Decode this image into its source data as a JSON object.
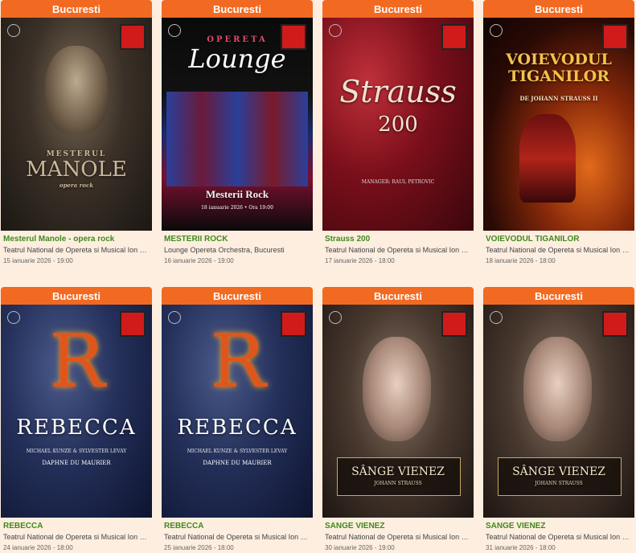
{
  "events": [
    {
      "city": "Bucuresti",
      "title": "Mesterul Manole - opera rock",
      "venue": "Teatrul National de Opereta si Musical Ion Dacia...",
      "date": "15 ianuarie 2026 - 19:00",
      "poster_title": "MANOLE",
      "poster_over": "MESTERUL",
      "poster_sub": "opera rock",
      "icon": "poster-mesterul-manole"
    },
    {
      "city": "Bucuresti",
      "title": "MESTERII ROCK",
      "venue": "Lounge Opereta Orchestra, Bucuresti",
      "date": "16 ianuarie 2026 - 19:00",
      "poster_title": "Lounge",
      "poster_over": "OPERETA",
      "poster_sub": "Mesterii Rock",
      "poster_extra": "18 ianuarie 2026 • Ora 19:00",
      "icon": "poster-mesterii-rock"
    },
    {
      "city": "Bucuresti",
      "title": "Strauss 200",
      "venue": "Teatrul National de Opereta si Musical Ion Dacia...",
      "date": "17 ianuarie 2026 - 18:00",
      "poster_title": "Strauss",
      "poster_sub": "200",
      "poster_extra": "MANAGER: RAUL PETROVIC",
      "icon": "poster-strauss-200"
    },
    {
      "city": "Bucuresti",
      "title": "VOIEVODUL TIGANILOR",
      "venue": "Teatrul National de Opereta si Musical Ion Dacia...",
      "date": "18 ianuarie 2026 - 18:00",
      "poster_title": "VOIEVODUL TIGANILOR",
      "poster_sub": "DE JOHANN STRAUSS II",
      "icon": "poster-voievodul-tiganilor"
    },
    {
      "city": "Bucuresti",
      "title": "REBECCA",
      "venue": "Teatrul National de Opereta si Musical Ion Dacia...",
      "date": "24 ianuarie 2026 - 18:00",
      "poster_title": "REBECCA",
      "poster_sub": "MICHAEL KUNZE & SYLVESTER LEVAY",
      "poster_extra": "DAPHNE DU MAURIER",
      "icon": "poster-rebecca"
    },
    {
      "city": "Bucuresti",
      "title": "REBECCA",
      "venue": "Teatrul National de Opereta si Musical Ion Dacia...",
      "date": "25 ianuarie 2026 - 18:00",
      "poster_title": "REBECCA",
      "poster_sub": "MICHAEL KUNZE & SYLVESTER LEVAY",
      "poster_extra": "DAPHNE DU MAURIER",
      "icon": "poster-rebecca"
    },
    {
      "city": "Bucuresti",
      "title": "SANGE VIENEZ",
      "venue": "Teatrul National de Opereta si Musical Ion Dacia...",
      "date": "30 ianuarie 2026 - 19:00",
      "poster_title": "SÂNGE VIENEZ",
      "poster_sub": "JOHANN STRAUSS",
      "icon": "poster-sange-vienez"
    },
    {
      "city": "Bucuresti",
      "title": "SANGE VIENEZ",
      "venue": "Teatrul National de Opereta si Musical Ion Dacia...",
      "date": "31 ianuarie 2026 - 18:00",
      "poster_title": "SÂNGE VIENEZ",
      "poster_sub": "JOHANN STRAUSS",
      "icon": "poster-sange-vienez"
    }
  ],
  "colors": {
    "background": "#fdeee0",
    "city_bar": "#f26a21",
    "title_green": "#3f8a1b"
  }
}
